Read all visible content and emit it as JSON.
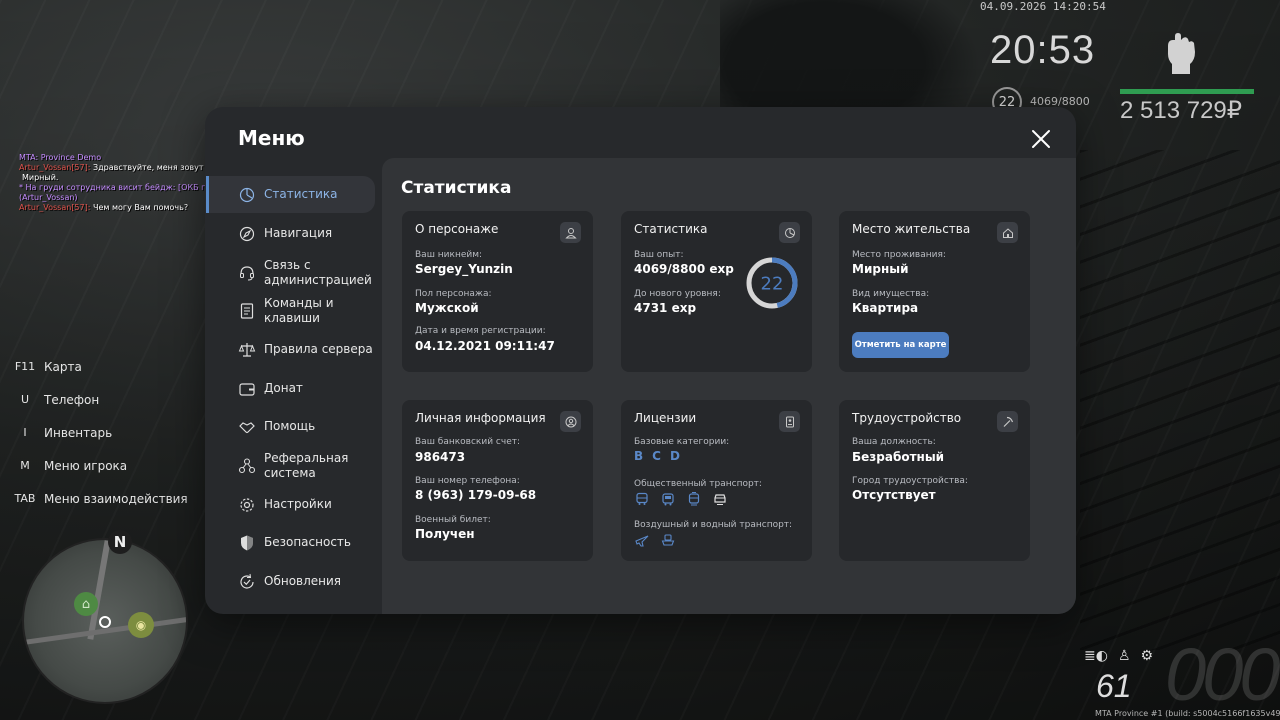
{
  "hud": {
    "datetime": "04.09.2026 14:20:54",
    "clock": "20:53",
    "level": "22",
    "exp": "4069/8800",
    "money": "2 513 729₽",
    "fuel": "61",
    "speed": "000",
    "build": "MTA Province #1 (build: s5004c5166f1635v4910"
  },
  "chat": [
    {
      "name": "MTA: Province Demo",
      "text": "",
      "color": "#c58cff"
    },
    {
      "name": "Artur_Vossan[57]:",
      "text": " Здравствуйте, меня зовут Артур Воссан, я интерн ОКБ города",
      "color": "#e0524b"
    },
    {
      "name": "",
      "text": "Мирный.",
      "color": "#e0524b"
    },
    {
      "name": "* На груди сотрудника висит бейдж: [ОКБ г. Мирный | Интерн | Воссан А.А.].",
      "text": "",
      "color": "#c58cff"
    },
    {
      "name": "(Artur_Vossan)",
      "text": "",
      "color": "#c58cff"
    },
    {
      "name": "Artur_Vossan[57]:",
      "text": " Чем могу Вам помочь?",
      "color": "#e0524b"
    }
  ],
  "keys": [
    {
      "key": "F11",
      "label": "Карта"
    },
    {
      "key": "U",
      "label": "Телефон"
    },
    {
      "key": "I",
      "label": "Инвентарь"
    },
    {
      "key": "M",
      "label": "Меню игрока"
    },
    {
      "key": "TAB",
      "label": "Меню взаимодействия"
    }
  ],
  "minimap": {
    "north": "N"
  },
  "menu": {
    "title": "Меню",
    "sidebar": [
      {
        "label": "Статистика",
        "icon": "stats-icon",
        "active": true
      },
      {
        "label": "Навигация",
        "icon": "compass-icon"
      },
      {
        "label": "Связь с\nадминистрацией",
        "icon": "headset-icon"
      },
      {
        "label": "Команды и\nклавиши",
        "icon": "document-icon"
      },
      {
        "label": "Правила сервера",
        "icon": "scales-icon"
      },
      {
        "label": "Донат",
        "icon": "wallet-icon"
      },
      {
        "label": "Помощь",
        "icon": "handshake-icon"
      },
      {
        "label": "Реферальная\nсистема",
        "icon": "referral-icon"
      },
      {
        "label": "Настройки",
        "icon": "gear-icon"
      },
      {
        "label": "Безопасность",
        "icon": "shield-icon"
      },
      {
        "label": "Обновления",
        "icon": "update-icon"
      }
    ],
    "content_title": "Статистика",
    "character": {
      "title": "О персонаже",
      "nick_label": "Ваш никнейм:",
      "nick": "Sergey_Yunzin",
      "gender_label": "Пол персонажа:",
      "gender": "Мужской",
      "reg_label": "Дата и время регистрации:",
      "reg": "04.12.2021 09:11:47"
    },
    "stats": {
      "title": "Статистика",
      "exp_label": "Ваш опыт:",
      "exp": "4069/8800 exp",
      "next_label": "До нового уровня:",
      "next": "4731 exp",
      "level": "22",
      "progress": 0.4624
    },
    "residence": {
      "title": "Место жительства",
      "place_label": "Место проживания:",
      "place": "Мирный",
      "type_label": "Вид имущества:",
      "type": "Квартира",
      "button": "Отметить на карте"
    },
    "personal": {
      "title": "Личная информация",
      "bank_label": "Ваш банковский счет:",
      "bank": "986473",
      "phone_label": "Ваш номер телефона:",
      "phone": "8 (963) 179-09-68",
      "military_label": "Военный билет:",
      "military": "Получен"
    },
    "licenses": {
      "title": "Лицензии",
      "base_label": "Базовые категории:",
      "categories": [
        "B",
        "C",
        "D"
      ],
      "public_label": "Общественный транспорт:",
      "air_label": "Воздушный и водный транспорт:"
    },
    "employment": {
      "title": "Трудоустройство",
      "position_label": "Ваша должность:",
      "position": "Безработный",
      "city_label": "Город трудоустройства:",
      "city": "Отсутствует"
    }
  }
}
